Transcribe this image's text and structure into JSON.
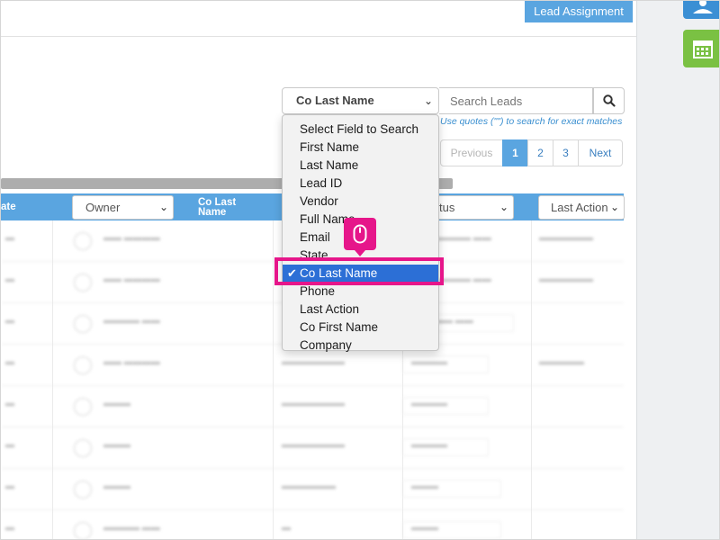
{
  "header": {
    "lead_assignment": "Lead Assignment"
  },
  "search": {
    "field_selected": "Co Last Name",
    "placeholder": "Search Leads",
    "hint": "Use quotes (\"\") to search for exact matches"
  },
  "pagination": {
    "previous": "Previous",
    "pages": [
      "1",
      "2",
      "3"
    ],
    "active_page": "1",
    "next": "Next"
  },
  "table": {
    "columns": {
      "first_partial": "ate",
      "owner": "Owner",
      "co_last_name": "Co Last Name",
      "status_partial": "tus",
      "last_action": "Last Action"
    }
  },
  "dropdown": {
    "options": [
      "Select Field to Search",
      "First Name",
      "Last Name",
      "Lead ID",
      "Vendor",
      "Full Name",
      "Email",
      "State",
      "Co Last Name",
      "Phone",
      "Last Action",
      "Co First Name",
      "Company"
    ],
    "selected_index": 8,
    "check_glyph": "✔"
  },
  "icons": {
    "chevron": "chevron-down-icon",
    "search": "search-icon",
    "mouse": "mouse-icon",
    "contacts": "contacts-icon",
    "calendar": "calendar-icon"
  },
  "colors": {
    "accent": "#5aa5e0",
    "highlight": "#e6168a",
    "selected": "#2c6fd6",
    "calendar": "#7ac143"
  }
}
